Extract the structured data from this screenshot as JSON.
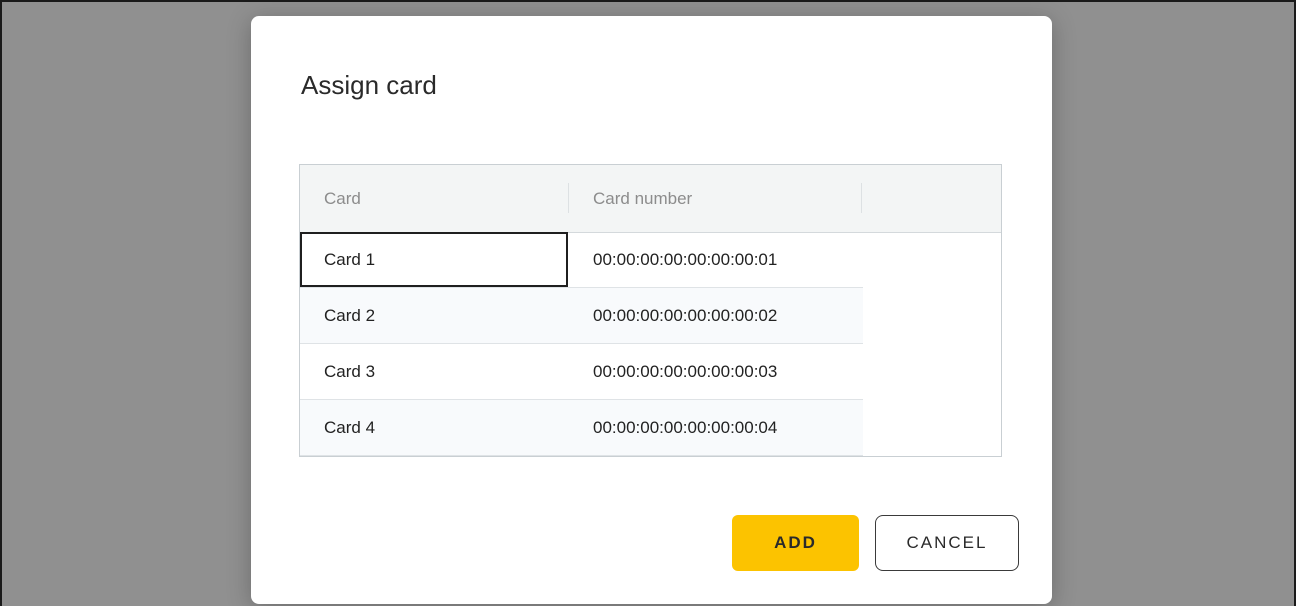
{
  "dialog": {
    "title": "Assign card"
  },
  "table": {
    "columns": [
      "Card",
      "Card number"
    ],
    "rows": [
      {
        "card": "Card 1",
        "number": "00:00:00:00:00:00:00:01"
      },
      {
        "card": "Card 2",
        "number": "00:00:00:00:00:00:00:02"
      },
      {
        "card": "Card 3",
        "number": "00:00:00:00:00:00:00:03"
      },
      {
        "card": "Card 4",
        "number": "00:00:00:00:00:00:00:04"
      }
    ],
    "focused_row": 0
  },
  "buttons": {
    "add_label": "ADD",
    "cancel_label": "CANCEL"
  },
  "colors": {
    "add_button": "#fcc300",
    "backdrop": "#909090"
  }
}
